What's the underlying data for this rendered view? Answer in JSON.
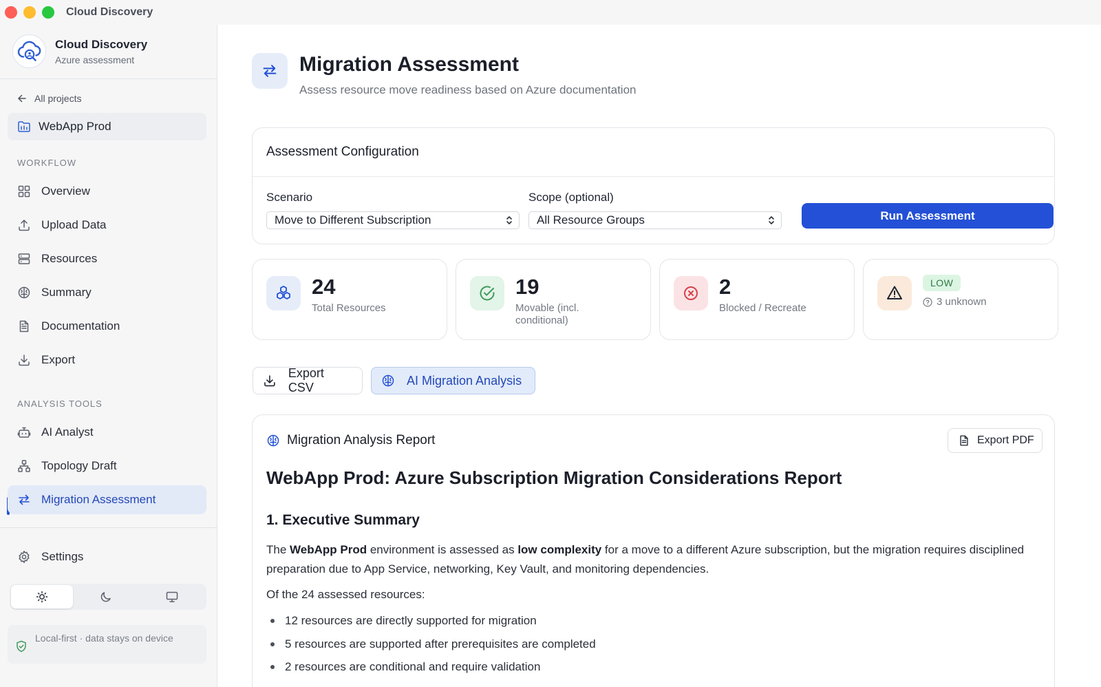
{
  "window": {
    "title": "Cloud Discovery"
  },
  "sidebar": {
    "brand": {
      "name": "Cloud Discovery",
      "subtitle": "Azure assessment"
    },
    "back_label": "All projects",
    "project": "WebApp Prod",
    "workflow_label": "WORKFLOW",
    "workflow_items": [
      {
        "label": "Overview",
        "icon": "grid-icon"
      },
      {
        "label": "Upload Data",
        "icon": "upload-icon"
      },
      {
        "label": "Resources",
        "icon": "server-icon"
      },
      {
        "label": "Summary",
        "icon": "brain-icon"
      },
      {
        "label": "Documentation",
        "icon": "document-icon"
      },
      {
        "label": "Export",
        "icon": "download-icon"
      }
    ],
    "tools_label": "ANALYSIS TOOLS",
    "tools_items": [
      {
        "label": "AI Analyst",
        "icon": "bot-icon"
      },
      {
        "label": "Topology Draft",
        "icon": "topology-icon"
      },
      {
        "label": "Migration Assessment",
        "icon": "swap-icon",
        "active": true
      }
    ],
    "settings_label": "Settings",
    "theme": {
      "selected": "light",
      "options": [
        "light",
        "dark",
        "system"
      ]
    },
    "local_note": "Local-first · data stays on device"
  },
  "page": {
    "title": "Migration Assessment",
    "subtitle": "Assess resource move readiness based on Azure documentation"
  },
  "config": {
    "title": "Assessment Configuration",
    "scenario_label": "Scenario",
    "scenario_value": "Move to Different Subscription",
    "scope_label": "Scope (optional)",
    "scope_value": "All Resource Groups",
    "run_label": "Run Assessment"
  },
  "stats": {
    "total": {
      "value": "24",
      "label": "Total Resources"
    },
    "movable": {
      "value": "19",
      "label": "Movable (incl. conditional)"
    },
    "blocked": {
      "value": "2",
      "label": "Blocked / Recreate"
    },
    "risk": {
      "badge": "LOW",
      "unknown": "3 unknown"
    }
  },
  "actions": {
    "export_csv": "Export CSV",
    "ai_analysis": "AI Migration Analysis"
  },
  "report": {
    "header": "Migration Analysis Report",
    "export_pdf": "Export PDF",
    "title": "WebApp Prod: Azure Subscription Migration Considerations Report",
    "section1": "1. Executive Summary",
    "p1": {
      "t1": "The ",
      "b1": "WebApp Prod",
      "t2": " environment is assessed as ",
      "b2": "low complexity",
      "t3": " for a move to a different Azure subscription, but the migration requires disciplined preparation due to App Service, networking, Key Vault, and monitoring dependencies."
    },
    "p2": "Of the 24 assessed resources:",
    "bullets": [
      "12 resources are directly supported for migration",
      "5 resources are supported after prerequisites are completed",
      "2 resources are conditional and require validation"
    ]
  },
  "colors": {
    "accent": "#2350d6",
    "active_nav_bg": "#e2e9f7",
    "success": "#3f9a5c",
    "danger": "#d8404a",
    "warning_bg": "#fbeadb",
    "risk_badge_bg": "#dcf5e3"
  }
}
